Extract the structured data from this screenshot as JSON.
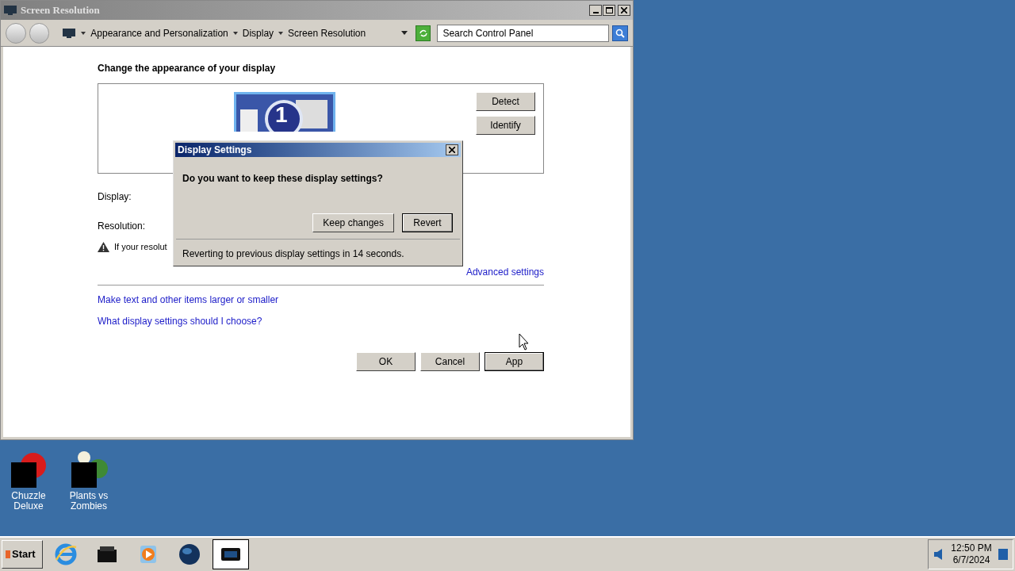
{
  "window": {
    "title": "Screen Resolution",
    "active": false
  },
  "breadcrumb": [
    "Appearance and Personalization",
    "Display",
    "Screen Resolution"
  ],
  "search": {
    "placeholder": "Search Control Panel"
  },
  "heading": "Change the appearance of your display",
  "monitor": {
    "number": "1"
  },
  "side_buttons": [
    "Detect",
    "Identify"
  ],
  "fields": [
    "Display:",
    "Resolution:"
  ],
  "warning": "If your resolut",
  "advanced_link": "Advanced settings",
  "links": [
    "Make text and other items larger or smaller",
    "What display settings should I choose?"
  ],
  "buttons": [
    {
      "label": "OK",
      "focused": false
    },
    {
      "label": "Cancel",
      "focused": false
    },
    {
      "label": "App",
      "focused": true
    }
  ],
  "dialog": {
    "title": "Display Settings",
    "question": "Do you want to keep these display settings?",
    "buttons": [
      {
        "label": "Keep changes",
        "focused": false
      },
      {
        "label": "Revert",
        "focused": true
      }
    ],
    "status": "Reverting to previous display settings in 14 seconds."
  },
  "desktop_icons": [
    {
      "label": "Chuzzle Deluxe",
      "kind": "chuzzle"
    },
    {
      "label": "Plants vs Zombies",
      "kind": "plants"
    }
  ],
  "taskbar": {
    "start": "Start",
    "apps": [
      {
        "kind": "browser",
        "selected": false
      },
      {
        "kind": "folder",
        "selected": false
      },
      {
        "kind": "media",
        "selected": false
      },
      {
        "kind": "globe",
        "selected": false
      },
      {
        "kind": "display",
        "selected": true
      }
    ],
    "time": "12:50 PM",
    "date": "6/7/2024"
  }
}
